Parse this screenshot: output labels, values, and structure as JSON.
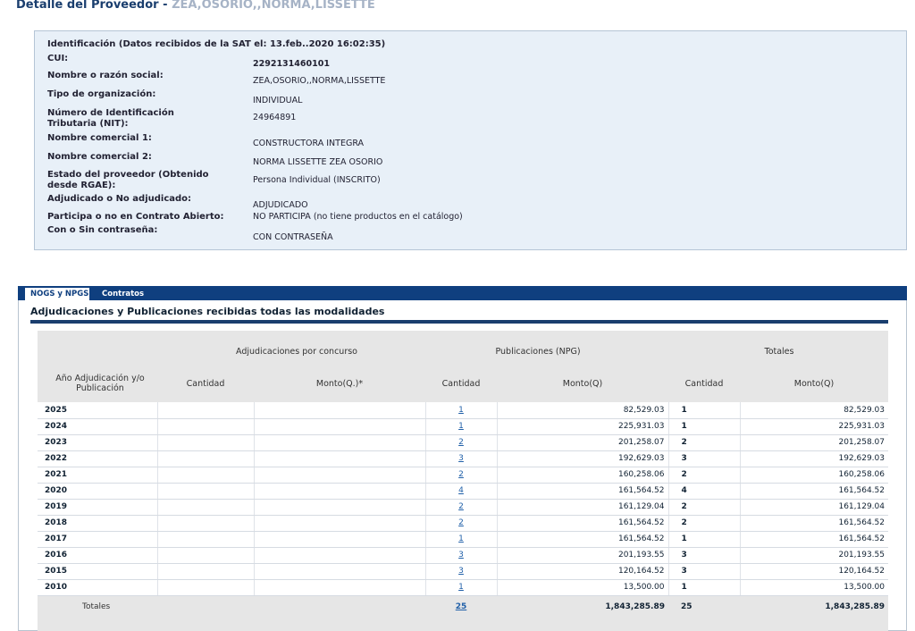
{
  "header": {
    "title": "Detalle del Proveedor",
    "separator": "-",
    "provider_name": "ZEA,OSORIO,,NORMA,LISSETTE"
  },
  "info": {
    "heading": "Identificación (Datos recibidos de la SAT el: 13.feb..2020 16:02:35)",
    "fields": [
      {
        "label": "CUI:",
        "value": "2292131460101"
      },
      {
        "label": "Nombre o razón social:",
        "value": "ZEA,OSORIO,,NORMA,LISSETTE"
      },
      {
        "label": "Tipo de organización:",
        "value": "INDIVIDUAL"
      },
      {
        "label": "Número de Identificación Tributaria (NIT):",
        "value": "24964891"
      },
      {
        "label": "Nombre comercial 1:",
        "value": "CONSTRUCTORA INTEGRA"
      },
      {
        "label": "Nombre comercial 2:",
        "value": "NORMA LISSETTE ZEA OSORIO"
      },
      {
        "label": "Estado del proveedor (Obtenido desde RGAE):",
        "value": "Persona Individual (INSCRITO)"
      },
      {
        "label": "Adjudicado o No adjudicado:",
        "value": "ADJUDICADO"
      },
      {
        "label": "Participa o no en Contrato Abierto:",
        "value": "NO PARTICIPA (no tiene productos en el catálogo)"
      },
      {
        "label": "Con o Sin contraseña:",
        "value": "CON CONTRASEÑA"
      }
    ]
  },
  "tabs": [
    {
      "label": "NOGS y NPGS",
      "active": true
    },
    {
      "label": "Contratos",
      "active": false
    }
  ],
  "section": {
    "title": "Adjudicaciones y Publicaciones recibidas todas las modalidades"
  },
  "table": {
    "group_headers": {
      "adjudicaciones": "Adjudicaciones por concurso",
      "publicaciones": "Publicaciones (NPG)",
      "totales": "Totales"
    },
    "columns": {
      "year": "Año Adjudicación y/o Publicación",
      "adj_cantidad": "Cantidad",
      "adj_monto": "Monto(Q.)*",
      "pub_cantidad": "Cantidad",
      "pub_monto": "Monto(Q)",
      "tot_cantidad": "Cantidad",
      "tot_monto": "Monto(Q)"
    },
    "rows": [
      {
        "year": "2025",
        "pub_cantidad": "1",
        "pub_monto": "82,529.03",
        "tot_cantidad": "1",
        "tot_monto": "82,529.03"
      },
      {
        "year": "2024",
        "pub_cantidad": "1",
        "pub_monto": "225,931.03",
        "tot_cantidad": "1",
        "tot_monto": "225,931.03"
      },
      {
        "year": "2023",
        "pub_cantidad": "2",
        "pub_monto": "201,258.07",
        "tot_cantidad": "2",
        "tot_monto": "201,258.07"
      },
      {
        "year": "2022",
        "pub_cantidad": "3",
        "pub_monto": "192,629.03",
        "tot_cantidad": "3",
        "tot_monto": "192,629.03"
      },
      {
        "year": "2021",
        "pub_cantidad": "2",
        "pub_monto": "160,258.06",
        "tot_cantidad": "2",
        "tot_monto": "160,258.06"
      },
      {
        "year": "2020",
        "pub_cantidad": "4",
        "pub_monto": "161,564.52",
        "tot_cantidad": "4",
        "tot_monto": "161,564.52"
      },
      {
        "year": "2019",
        "pub_cantidad": "2",
        "pub_monto": "161,129.04",
        "tot_cantidad": "2",
        "tot_monto": "161,129.04"
      },
      {
        "year": "2018",
        "pub_cantidad": "2",
        "pub_monto": "161,564.52",
        "tot_cantidad": "2",
        "tot_monto": "161,564.52"
      },
      {
        "year": "2017",
        "pub_cantidad": "1",
        "pub_monto": "161,564.52",
        "tot_cantidad": "1",
        "tot_monto": "161,564.52"
      },
      {
        "year": "2016",
        "pub_cantidad": "3",
        "pub_monto": "201,193.55",
        "tot_cantidad": "3",
        "tot_monto": "201,193.55"
      },
      {
        "year": "2015",
        "pub_cantidad": "3",
        "pub_monto": "120,164.52",
        "tot_cantidad": "3",
        "tot_monto": "120,164.52"
      },
      {
        "year": "2010",
        "pub_cantidad": "1",
        "pub_monto": "13,500.00",
        "tot_cantidad": "1",
        "tot_monto": "13,500.00"
      }
    ],
    "totals": {
      "label": "Totales",
      "pub_cantidad": "25",
      "pub_monto": "1,843,285.89",
      "tot_cantidad": "25",
      "tot_monto": "1,843,285.89"
    }
  },
  "colors": {
    "nav_bar": "#0f3f7f",
    "title_blue": "#1a3e6e",
    "info_bg": "#e8f0f8",
    "link": "#1f5fa8"
  }
}
